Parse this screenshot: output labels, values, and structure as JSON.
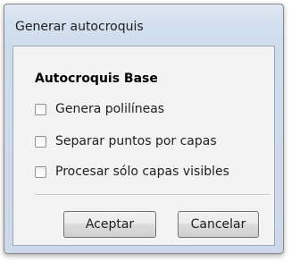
{
  "window": {
    "title": "Generar autocroquis"
  },
  "group": {
    "heading": "Autocroquis Base",
    "options": [
      {
        "label": "Genera polilíneas",
        "checked": false
      },
      {
        "label": "Separar puntos por capas",
        "checked": false
      },
      {
        "label": "Procesar sólo capas visibles",
        "checked": false
      }
    ]
  },
  "buttons": {
    "ok_label": "Aceptar",
    "cancel_label": "Cancelar"
  }
}
